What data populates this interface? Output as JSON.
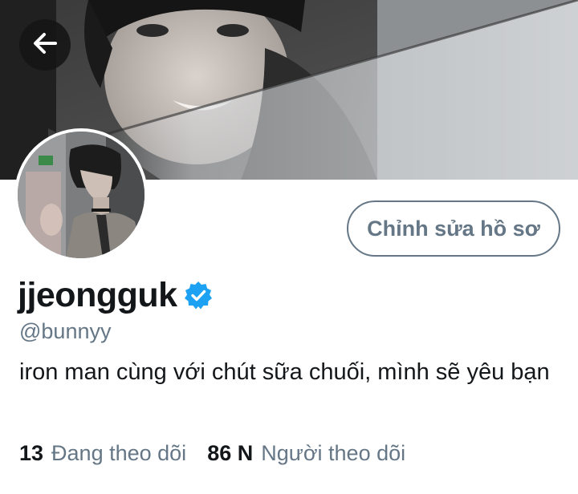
{
  "profile": {
    "display_name": "jjeongguk",
    "handle": "@bunnyy",
    "bio": "iron man cùng với chút sữa chuối, mình sẽ yêu bạn",
    "verified": true
  },
  "actions": {
    "edit_profile_label": "Chỉnh sửa hồ sơ"
  },
  "stats": {
    "following_count": "13",
    "following_label": "Đang theo dõi",
    "followers_count": "86 N",
    "followers_label": "Người theo dõi"
  },
  "icons": {
    "back": "arrow-left-icon",
    "verified": "verified-badge-icon"
  },
  "colors": {
    "text_primary": "#14171a",
    "text_secondary": "#657786",
    "verified_blue": "#1da1f2"
  }
}
